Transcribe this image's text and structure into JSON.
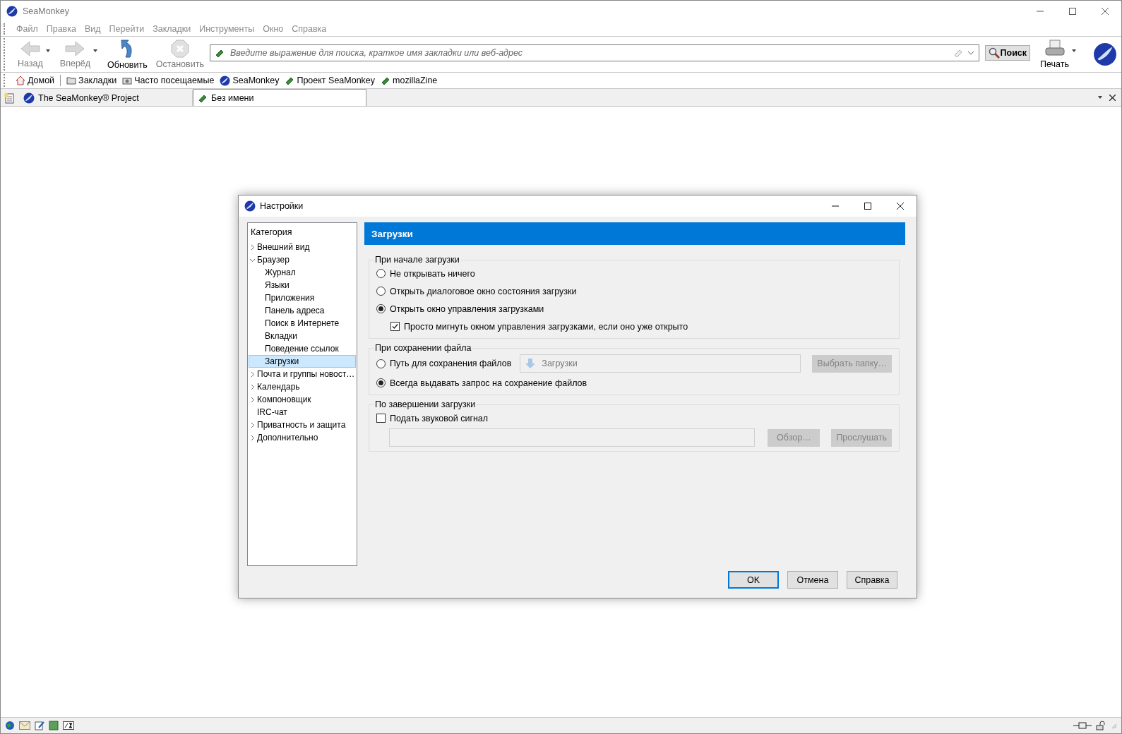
{
  "window": {
    "title": "SeaMonkey"
  },
  "menu": [
    "Файл",
    "Правка",
    "Вид",
    "Перейти",
    "Закладки",
    "Инструменты",
    "Окно",
    "Справка"
  ],
  "nav_buttons": [
    {
      "label": "Назад",
      "kind": "back",
      "disabled": true,
      "dropdown": true
    },
    {
      "label": "Вперёд",
      "kind": "forward",
      "disabled": true,
      "dropdown": true
    },
    {
      "label": "Обновить",
      "kind": "reload",
      "disabled": false,
      "dropdown": false
    },
    {
      "label": "Остановить",
      "kind": "stop",
      "disabled": true,
      "dropdown": false
    }
  ],
  "address": {
    "placeholder": "Введите выражение для поиска, краткое имя закладки или веб-адрес"
  },
  "search_button": "Поиск",
  "print_button": "Печать",
  "bookmarks": [
    {
      "label": "Домой",
      "kind": "home"
    },
    {
      "label": "Закладки",
      "kind": "folder"
    },
    {
      "label": "Часто посещаемые",
      "kind": "smart"
    },
    {
      "label": "SeaMonkey",
      "kind": "site"
    },
    {
      "label": "Проект SeaMonkey",
      "kind": "page"
    },
    {
      "label": "mozillaZine",
      "kind": "page"
    }
  ],
  "tabs": [
    {
      "label": "The SeaMonkey® Project",
      "kind": "site",
      "selected": false
    },
    {
      "label": "Без имени",
      "kind": "page",
      "selected": true
    }
  ],
  "dialog": {
    "title": "Настройки",
    "category_heading": "Категория",
    "categories": [
      {
        "label": "Внешний вид",
        "expanded": false,
        "selected": false
      },
      {
        "label": "Браузер",
        "expanded": true,
        "selected": false,
        "children": [
          {
            "label": "Журнал",
            "selected": false
          },
          {
            "label": "Языки",
            "selected": false
          },
          {
            "label": "Приложения",
            "selected": false
          },
          {
            "label": "Панель адреса",
            "selected": false
          },
          {
            "label": "Поиск в Интернете",
            "selected": false
          },
          {
            "label": "Вкладки",
            "selected": false
          },
          {
            "label": "Поведение ссылок",
            "selected": false
          },
          {
            "label": "Загрузки",
            "selected": true
          }
        ]
      },
      {
        "label": "Почта и группы новост…",
        "expanded": false,
        "selected": false
      },
      {
        "label": "Календарь",
        "expanded": false,
        "selected": false
      },
      {
        "label": "Компоновщик",
        "expanded": false,
        "selected": false
      },
      {
        "label": "IRC-чат",
        "selected": false
      },
      {
        "label": "Приватность и защита",
        "expanded": false,
        "selected": false
      },
      {
        "label": "Дополнительно",
        "expanded": false,
        "selected": false
      }
    ],
    "panel_title": "Загрузки",
    "groups": [
      {
        "legend": "При начале загрузки",
        "rows": [
          {
            "kind": "radio",
            "label": "Не открывать ничего",
            "selected": false
          },
          {
            "kind": "radio",
            "label": "Открыть диалоговое окно состояния загрузки",
            "selected": false
          },
          {
            "kind": "radio",
            "label": "Открыть окно управления загрузками",
            "selected": true
          },
          {
            "kind": "subcheckbox",
            "label": "Просто мигнуть окном управления загрузками, если оно уже открыто",
            "checked": true
          }
        ]
      },
      {
        "legend": "При сохранении файла",
        "rows": [
          {
            "kind": "path",
            "label": "Путь для сохранения файлов",
            "selected": false,
            "value": "Загрузки",
            "button": "Выбрать папку…",
            "disabled": true
          },
          {
            "kind": "radio",
            "label": "Всегда выдавать запрос на сохранение файлов",
            "selected": true
          }
        ]
      },
      {
        "legend": "По завершении загрузки",
        "rows": [
          {
            "kind": "checkbox",
            "label": "Подать звуковой сигнал",
            "checked": false
          },
          {
            "kind": "file",
            "buttons": [
              "Обзор…",
              "Прослушать"
            ],
            "disabled": true
          }
        ]
      }
    ],
    "buttons": [
      {
        "label": "OK",
        "default": true
      },
      {
        "label": "Отмена",
        "default": false
      },
      {
        "label": "Справка",
        "default": false
      }
    ]
  }
}
